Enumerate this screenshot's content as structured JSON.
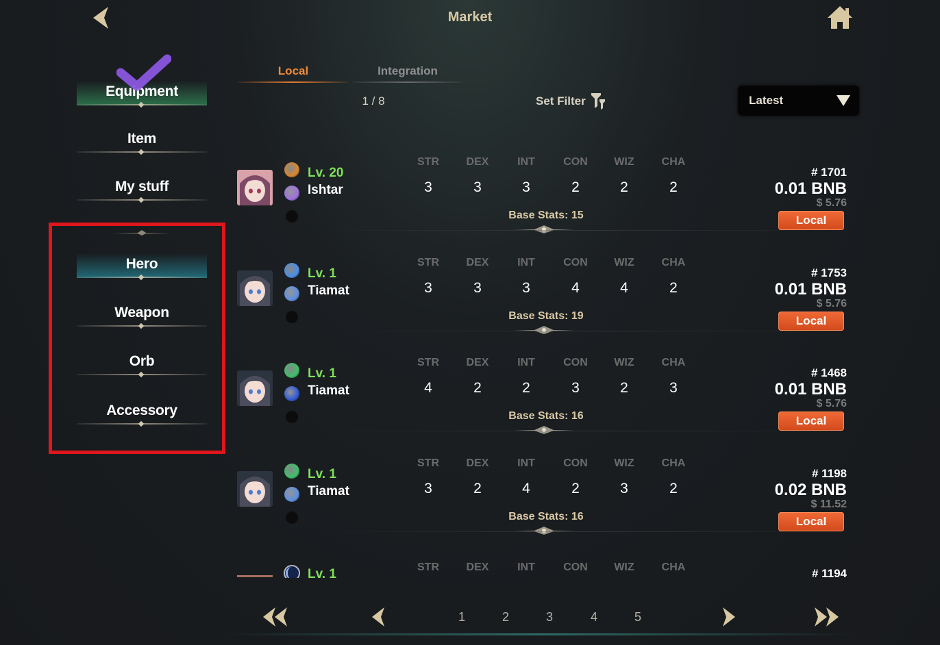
{
  "header": {
    "title": "Market"
  },
  "menu": {
    "main_items": [
      {
        "label": "Equipment"
      },
      {
        "label": "Item"
      },
      {
        "label": "My stuff"
      }
    ],
    "sub_items": [
      {
        "label": "Hero"
      },
      {
        "label": "Weapon"
      },
      {
        "label": "Orb"
      },
      {
        "label": "Accessory"
      }
    ]
  },
  "tabs": [
    {
      "label": "Local"
    },
    {
      "label": "Integration"
    }
  ],
  "toolbar": {
    "page_indicator": "1 / 8",
    "set_filter_label": "Set Filter",
    "sort_value": "Latest"
  },
  "stat_headers": [
    "STR",
    "DEX",
    "INT",
    "CON",
    "WIZ",
    "CHA"
  ],
  "listings": [
    {
      "level": "Lv. 20",
      "name": "Ishtar",
      "stats": [
        "3",
        "3",
        "3",
        "2",
        "2",
        "2"
      ],
      "base_stats": "Base Stats: 15",
      "id": "# 1701",
      "price": "0.01 BNB",
      "usd": "$ 5.76",
      "tag": "Local",
      "element_color": "#d9862e",
      "class_color": "#9f6fe0"
    },
    {
      "level": "Lv. 1",
      "name": "Tiamat",
      "stats": [
        "3",
        "3",
        "3",
        "4",
        "4",
        "2"
      ],
      "base_stats": "Base Stats: 19",
      "id": "# 1753",
      "price": "0.01 BNB",
      "usd": "$ 5.76",
      "tag": "Local",
      "element_color": "#4a8ee8",
      "class_color": "#5d8fe0"
    },
    {
      "level": "Lv. 1",
      "name": "Tiamat",
      "stats": [
        "4",
        "2",
        "2",
        "3",
        "2",
        "3"
      ],
      "base_stats": "Base Stats: 16",
      "id": "# 1468",
      "price": "0.01 BNB",
      "usd": "$ 5.76",
      "tag": "Local",
      "element_color": "#3dbf6a",
      "class_color": "#3058d8"
    },
    {
      "level": "Lv. 1",
      "name": "Tiamat",
      "stats": [
        "3",
        "2",
        "4",
        "2",
        "3",
        "2"
      ],
      "base_stats": "Base Stats: 16",
      "id": "# 1198",
      "price": "0.02 BNB",
      "usd": "$ 11.52",
      "tag": "Local",
      "element_color": "#3dbf6a",
      "class_color": "#5d8fe0"
    },
    {
      "level": "Lv. 1",
      "id": "# 1194"
    }
  ],
  "pagination": {
    "pages": [
      "1",
      "2",
      "3",
      "4",
      "5"
    ]
  },
  "colors": {
    "accent_orange": "#e27a36",
    "level_green": "#7fe05a",
    "highlight_red": "#e0161d"
  }
}
